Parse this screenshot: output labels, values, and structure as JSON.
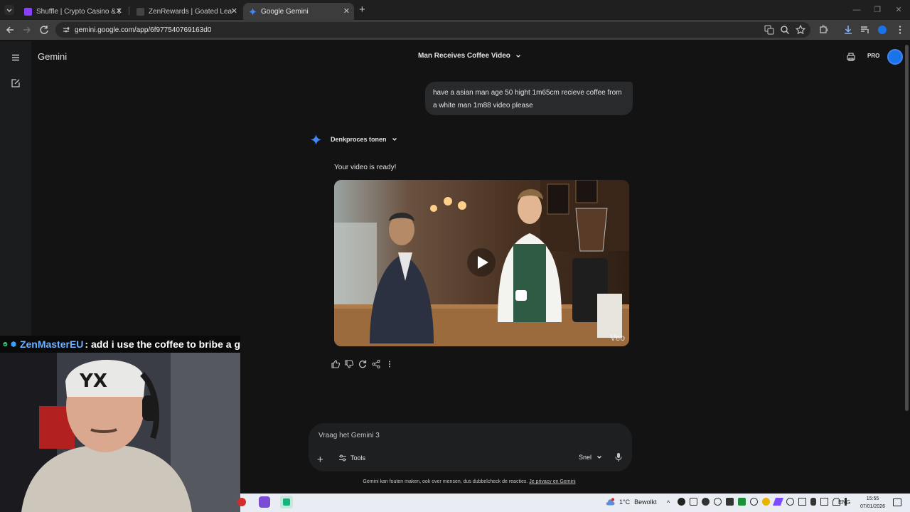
{
  "browser": {
    "tabs": [
      {
        "title": "Shuffle | Crypto Casino & Bitcoin",
        "favicon_color": "#8a3ffc"
      },
      {
        "title": "ZenRewards | Goated Leaderboard",
        "favicon_color": "#444444"
      },
      {
        "title": "Google Gemini",
        "favicon_color": "#4285f4"
      }
    ],
    "url": "gemini.google.com/app/6f977540769163d0"
  },
  "gemini": {
    "brand": "Gemini",
    "conversation_title": "Man Receives Coffee Video",
    "pro_badge": "PRO",
    "user_prompt": "have a asian man age 50 hight 1m65cm recieve coffee from a white man 1m88 video please",
    "thinking_toggle": "Denkproces tonen",
    "response_text": "Your video is ready!",
    "video_watermark": "Veo",
    "composer": {
      "placeholder": "Vraag het Gemini 3",
      "tools_label": "Tools",
      "mode_label": "Snel"
    },
    "disclaimer": "Gemini kan fouten maken, ook over mensen, dus dubbelcheck de reacties.",
    "privacy_link": "Je privacy en Gemini"
  },
  "stream_chat": {
    "username": "ZenMasterEU",
    "message": ": add i use the coffee to bribe a g"
  },
  "taskbar": {
    "temperature": "1°C",
    "weather": "Bewolkt",
    "language": "ENG",
    "time": "15:55",
    "date": "07/01/2026"
  },
  "colors": {
    "accent_blue": "#4285f4",
    "background": "#131314",
    "chat_username": "#6fb0ff"
  }
}
